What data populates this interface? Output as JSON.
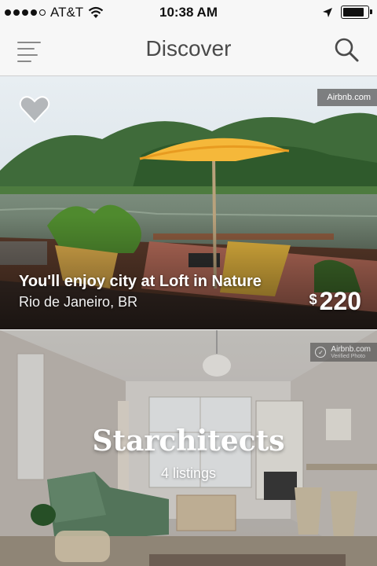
{
  "status_bar": {
    "carrier": "AT&T",
    "time": "10:38 AM",
    "signal_dots_filled": 4,
    "signal_dots_total": 5
  },
  "nav": {
    "title": "Discover",
    "menu_icon": "hamburger-menu-icon",
    "search_icon": "search-icon"
  },
  "listing": {
    "title": "You'll enjoy city at Loft in Nature",
    "location": "Rio de Janeiro, BR",
    "currency": "$",
    "price": "220",
    "watermark": "Airbnb.com",
    "favorite_icon": "heart-icon"
  },
  "collection": {
    "title": "Starchitects",
    "count": "4 listings",
    "watermark": "Airbnb.com",
    "watermark_sub": "Verified Photo"
  },
  "colors": {
    "nav_bg": "#f7f7f7",
    "nav_title": "#4a4a4a",
    "umbrella": "#f5b83a"
  }
}
